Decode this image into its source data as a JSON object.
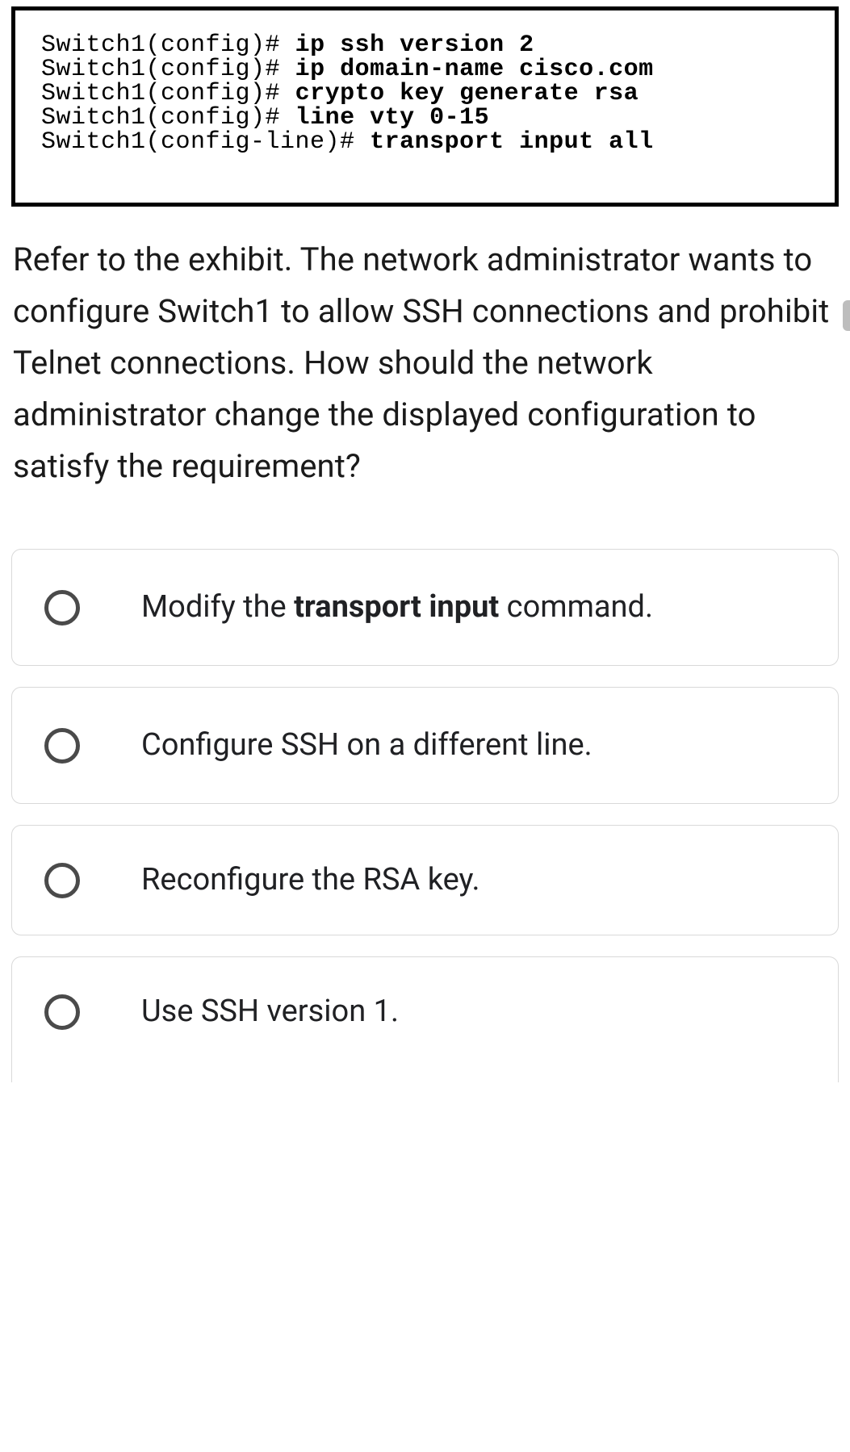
{
  "exhibit": {
    "lines": [
      {
        "prompt": "Switch1(config)# ",
        "cmd": "ip ssh version 2"
      },
      {
        "prompt": "Switch1(config)# ",
        "cmd": "ip domain-name cisco.com"
      },
      {
        "prompt": "Switch1(config)# ",
        "cmd": "crypto key generate rsa"
      },
      {
        "prompt": "Switch1(config)# ",
        "cmd": "line vty 0-15"
      },
      {
        "prompt": "Switch1(config-line)# ",
        "cmd": "transport input all"
      }
    ]
  },
  "question": "Refer to the exhibit. The network administrator wants to configure Switch1 to allow SSH connections and prohibit Telnet connections. How should the network administrator change the displayed configuration to satisfy the requirement?",
  "options": [
    {
      "pre": "Modify the ",
      "bold": "transport input",
      "post": " command."
    },
    {
      "pre": "Configure SSH on a different line.",
      "bold": "",
      "post": ""
    },
    {
      "pre": "Reconfigure the RSA key.",
      "bold": "",
      "post": ""
    },
    {
      "pre": "Use SSH version 1.",
      "bold": "",
      "post": ""
    }
  ]
}
